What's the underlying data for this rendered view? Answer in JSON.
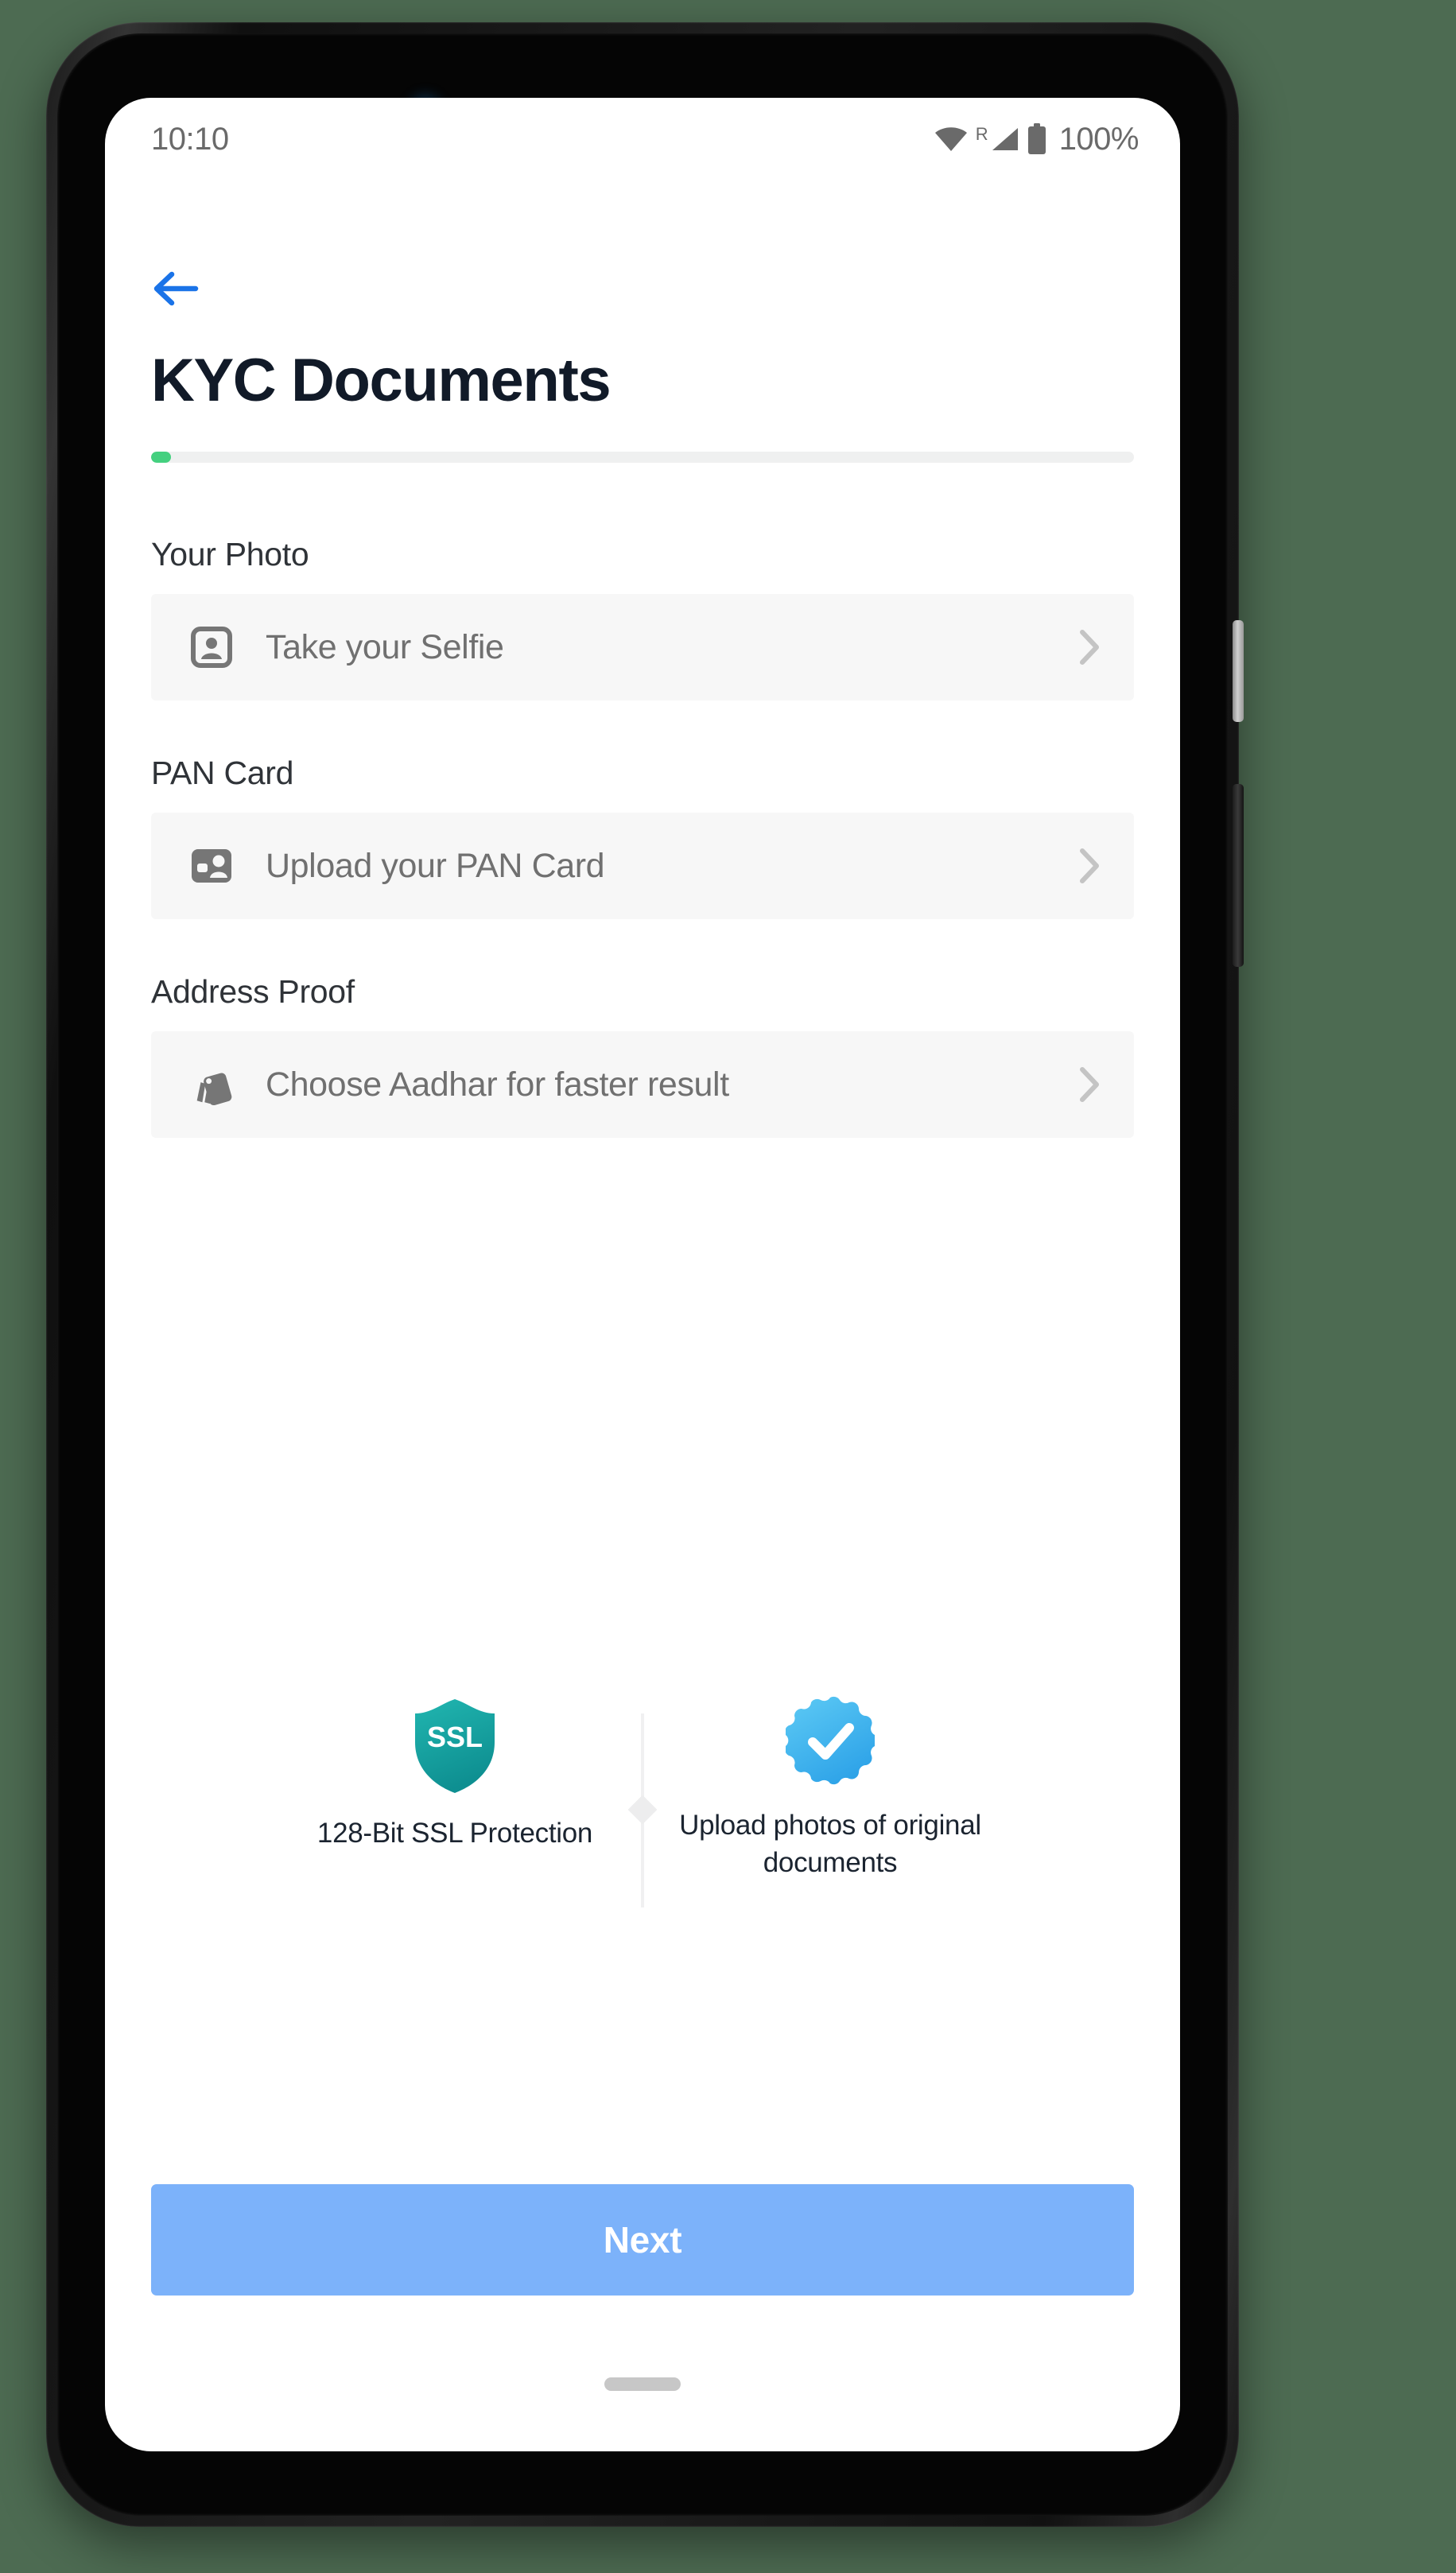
{
  "status_bar": {
    "time": "10:10",
    "battery_percent": "100%",
    "network_indicator": "R",
    "icons": [
      "wifi-icon",
      "cellular-signal-icon",
      "battery-icon"
    ]
  },
  "header": {
    "back_icon": "arrow-left-icon",
    "title": "KYC Documents"
  },
  "progress": {
    "percent": 2,
    "fill_color": "#44d07f",
    "track_color": "#eff0f0"
  },
  "fields": [
    {
      "label": "Your Photo",
      "value": "Take your Selfie",
      "icon": "account-box-outline-icon",
      "chevron": "chevron-right-icon"
    },
    {
      "label": "PAN Card",
      "value": "Upload your PAN Card",
      "icon": "id-card-filled-icon",
      "chevron": "chevron-right-icon"
    },
    {
      "label": "Address Proof",
      "value": "Choose Aadhar for faster result",
      "icon": "stacked-documents-icon",
      "chevron": "chevron-right-icon"
    }
  ],
  "trust": [
    {
      "icon": "ssl-shield-icon",
      "badge_text": "SSL",
      "caption": "128-Bit SSL Protection",
      "color": "#17a8a4"
    },
    {
      "icon": "verified-check-badge-icon",
      "caption": "Upload photos of original documents",
      "color": "#4db9f0"
    }
  ],
  "primary_action": {
    "label": "Next",
    "color": "#7cb2fa"
  },
  "system_nav": {
    "home_indicator": "home-indicator"
  },
  "device": {
    "front_camera": "front-camera",
    "earpiece": "earpiece-speaker",
    "power_button": "power-button",
    "volume_rocker": "volume-rocker"
  }
}
